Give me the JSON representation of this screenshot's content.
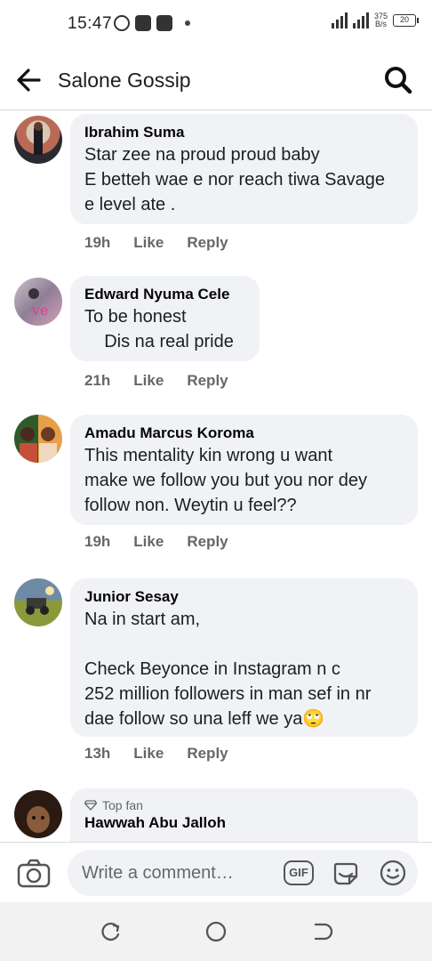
{
  "status_bar": {
    "time": "15:47",
    "network_speed": "375",
    "network_unit": "B/s",
    "battery": "20"
  },
  "header": {
    "title": "Salone Gossip"
  },
  "comments": [
    {
      "author": "Ibrahim Suma",
      "text": "Star zee na proud proud baby\nE betteh wae e nor reach tiwa Savage\ne level ate .",
      "time": "19h",
      "like": "Like",
      "reply": "Reply"
    },
    {
      "author": "Edward Nyuma Cele",
      "text": "To be honest\n    Dis na real pride",
      "time": "21h",
      "like": "Like",
      "reply": "Reply"
    },
    {
      "author": "Amadu Marcus Koroma",
      "text": "This mentality kin wrong u want\nmake we follow you but you nor dey\nfollow non. Weytin u feel??",
      "time": "19h",
      "like": "Like",
      "reply": "Reply"
    },
    {
      "author": "Junior Sesay",
      "text": "Na in start am,\n\nCheck Beyonce in Instagram n c\n252 million followers in man sef in nr\ndae follow so una leff we ya🙄",
      "time": "13h",
      "like": "Like",
      "reply": "Reply"
    },
    {
      "badge": "Top fan",
      "author": "Hawwah Abu Jalloh"
    }
  ],
  "composer": {
    "placeholder": "Write a comment…",
    "gif_label": "GIF"
  },
  "colors": {
    "bubble": "#f0f2f5",
    "meta_text": "#65676b",
    "primary_text": "#050505"
  }
}
